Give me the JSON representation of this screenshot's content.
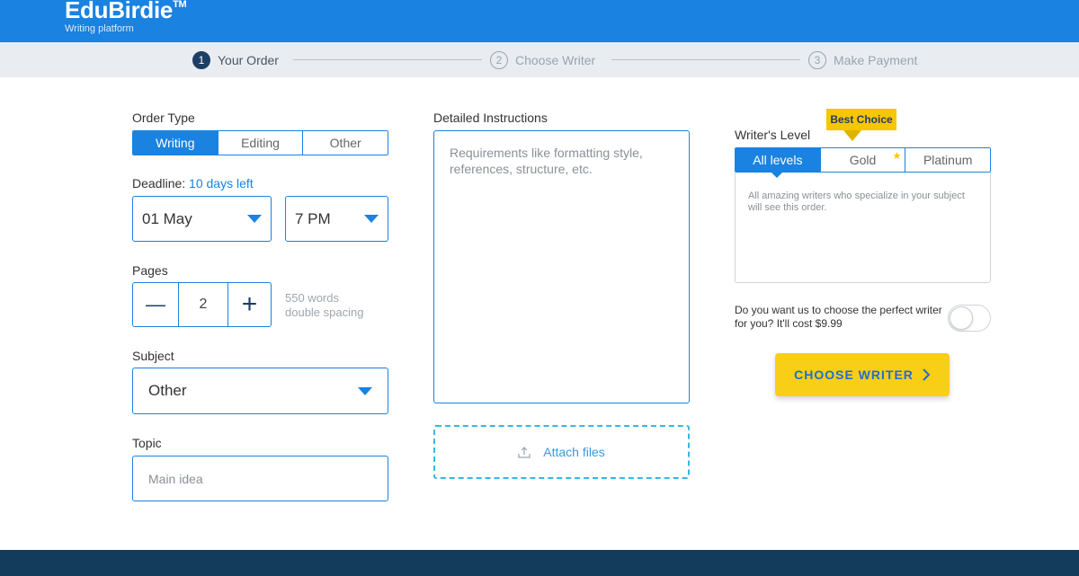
{
  "brand": {
    "name": "EduBirdie",
    "tm": "TM",
    "tagline": "Writing platform"
  },
  "steps": [
    {
      "num": "1",
      "label": "Your Order",
      "active": true
    },
    {
      "num": "2",
      "label": "Choose Writer",
      "active": false
    },
    {
      "num": "3",
      "label": "Make Payment",
      "active": false
    }
  ],
  "order_type": {
    "label": "Order Type",
    "options": [
      "Writing",
      "Editing",
      "Other"
    ],
    "selected": "Writing"
  },
  "deadline": {
    "label": "Deadline:",
    "remaining": "10 days left",
    "date": "01 May",
    "time": "7 PM"
  },
  "pages": {
    "label": "Pages",
    "minus": "—",
    "value": "2",
    "plus": "+",
    "words": "550 words",
    "spacing": "double spacing"
  },
  "subject": {
    "label": "Subject",
    "value": "Other"
  },
  "topic": {
    "label": "Topic",
    "placeholder": "Main idea"
  },
  "instructions": {
    "label": "Detailed Instructions",
    "placeholder": "Requirements like formatting style, references, structure, etc."
  },
  "attach": {
    "label": "Attach files"
  },
  "writer_level": {
    "label": "Writer's Level",
    "badge": "Best Choice",
    "options": [
      "All levels",
      "Gold",
      "Platinum"
    ],
    "selected": "All levels",
    "description": "All amazing writers who specialize in your subject will see this order."
  },
  "perfect_writer": {
    "text": "Do you want us to choose the perfect writer for you? It'll cost $9.99",
    "enabled": false
  },
  "cta": {
    "label": "CHOOSE WRITER"
  },
  "colors": {
    "primary": "#1a82e0",
    "accent": "#f9ce16",
    "navy": "#123b5c"
  }
}
